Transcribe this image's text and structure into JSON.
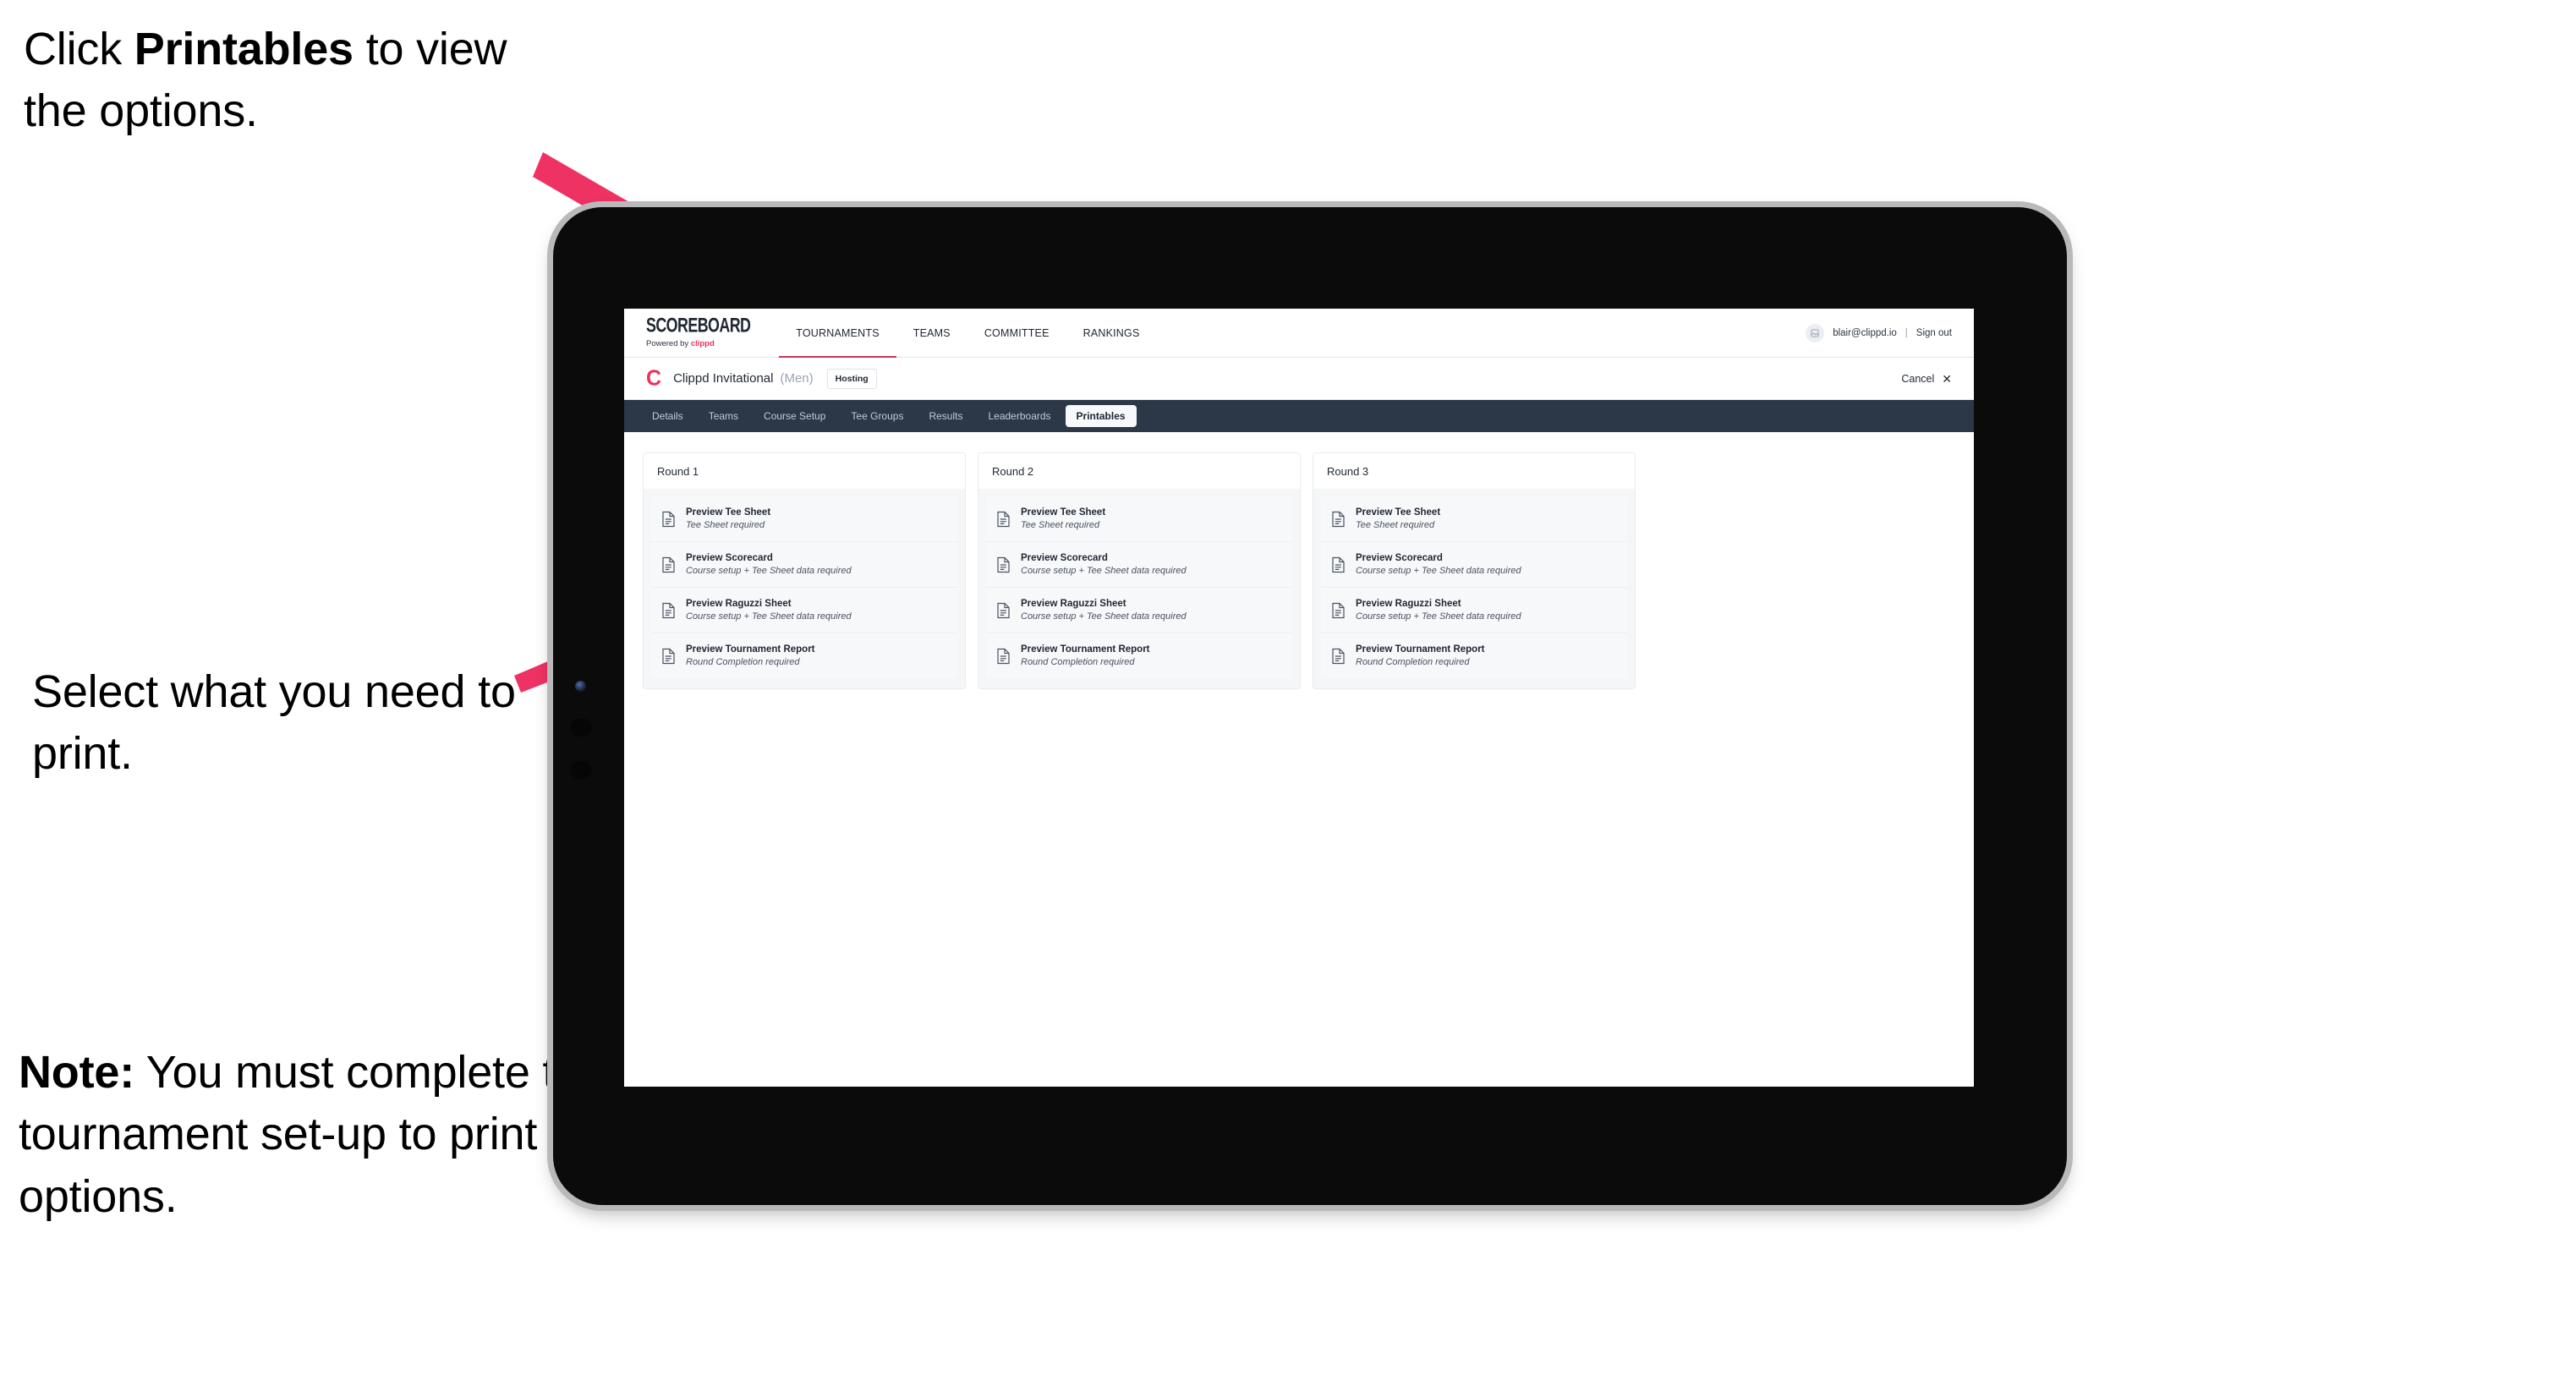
{
  "annotations": {
    "top": {
      "pre": "Click ",
      "bold": "Printables",
      "post": " to view the options."
    },
    "middle": {
      "text": "Select what you need to print."
    },
    "note": {
      "bold": "Note:",
      "post": " You must complete the tournament set-up to print all the options."
    }
  },
  "colors": {
    "arrow": "#ee3263",
    "brand_pink": "#e8345c",
    "tabbar_dark": "#2c3747"
  },
  "browser": {
    "topnav": {
      "logo": {
        "word": "SCOREBOARD",
        "sub_prefix": "Powered by ",
        "sub_brand": "clippd"
      },
      "items": [
        {
          "label": "TOURNAMENTS",
          "active": true
        },
        {
          "label": "TEAMS",
          "active": false
        },
        {
          "label": "COMMITTEE",
          "active": false
        },
        {
          "label": "RANKINGS",
          "active": false
        }
      ],
      "account": {
        "avatar_icon": "user-avatar-icon",
        "email": "blair@clippd.io",
        "divider": "|",
        "signout": "Sign out"
      }
    },
    "tournament_header": {
      "logo_mark": "C",
      "name": "Clippd Invitational",
      "gender": "(Men)",
      "status_chip": "Hosting",
      "cancel_label": "Cancel",
      "cancel_icon": "✕"
    },
    "tabs": [
      {
        "label": "Details",
        "active": false
      },
      {
        "label": "Teams",
        "active": false
      },
      {
        "label": "Course Setup",
        "active": false
      },
      {
        "label": "Tee Groups",
        "active": false
      },
      {
        "label": "Results",
        "active": false
      },
      {
        "label": "Leaderboards",
        "active": false
      },
      {
        "label": "Printables",
        "active": true
      }
    ],
    "rounds": [
      {
        "title": "Round 1",
        "items": [
          {
            "title": "Preview Tee Sheet",
            "sub": "Tee Sheet required"
          },
          {
            "title": "Preview Scorecard",
            "sub": "Course setup + Tee Sheet data required"
          },
          {
            "title": "Preview Raguzzi Sheet",
            "sub": "Course setup + Tee Sheet data required"
          },
          {
            "title": "Preview Tournament Report",
            "sub": "Round Completion required"
          }
        ]
      },
      {
        "title": "Round 2",
        "items": [
          {
            "title": "Preview Tee Sheet",
            "sub": "Tee Sheet required"
          },
          {
            "title": "Preview Scorecard",
            "sub": "Course setup + Tee Sheet data required"
          },
          {
            "title": "Preview Raguzzi Sheet",
            "sub": "Course setup + Tee Sheet data required"
          },
          {
            "title": "Preview Tournament Report",
            "sub": "Round Completion required"
          }
        ]
      },
      {
        "title": "Round 3",
        "items": [
          {
            "title": "Preview Tee Sheet",
            "sub": "Tee Sheet required"
          },
          {
            "title": "Preview Scorecard",
            "sub": "Course setup + Tee Sheet data required"
          },
          {
            "title": "Preview Raguzzi Sheet",
            "sub": "Course setup + Tee Sheet data required"
          },
          {
            "title": "Preview Tournament Report",
            "sub": "Round Completion required"
          }
        ]
      }
    ]
  }
}
